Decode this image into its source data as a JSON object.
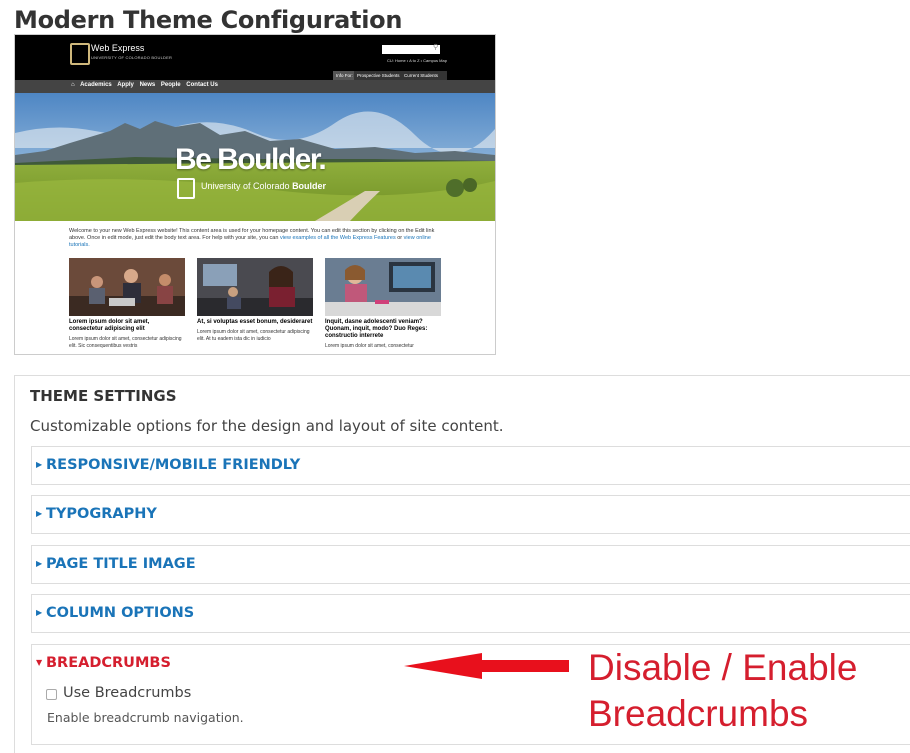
{
  "page": {
    "title": "Modern Theme Configuration"
  },
  "preview": {
    "site_name": "Web Express",
    "site_sub": "UNIVERSITY OF COLORADO BOULDER",
    "top_links": "CU: Home • A to Z • Campus Map",
    "info_for_label": "Info For:",
    "info_for_items": [
      "Prospective Students",
      "Current Students"
    ],
    "nav_items": [
      "Academics",
      "Apply",
      "News",
      "People",
      "Contact Us"
    ],
    "hero_title": "Be Boulder.",
    "hero_sub_regular": "University of Colorado",
    "hero_sub_bold": "Boulder",
    "intro_text": "Welcome to your new Web Express website! This content area is used for your homepage content. You can edit this section by clicking on the Edit link above. Once in edit mode, just edit the body text area. For help with your site, you can",
    "intro_link1": "view examples of all the Web Express Features",
    "intro_or": "or",
    "intro_link2": "view online tutorials.",
    "cards": [
      {
        "title": "Lorem ipsum dolor sit amet, consectetur adipiscing elit",
        "body": "Lorem ipsum dolor sit amet, consectetur adipiscing elit. Sic consequentibus vestris"
      },
      {
        "title": "At, si voluptas esset bonum, desideraret",
        "body": "Lorem ipsum dolor sit amet, consectetur adipiscing elit. At tu eadem ista dic in iudicio"
      },
      {
        "title": "Inquit, dasne adolescenti veniam? Quonam, inquit, modo? Duo Reges: constructio interrete",
        "body": "Lorem ipsum dolor sit amet, consectetur"
      }
    ]
  },
  "settings": {
    "title": "THEME SETTINGS",
    "description": "Customizable options for the design and layout of site content.",
    "sections": [
      {
        "label": "RESPONSIVE/MOBILE FRIENDLY",
        "expanded": false
      },
      {
        "label": "TYPOGRAPHY",
        "expanded": false
      },
      {
        "label": "PAGE TITLE IMAGE",
        "expanded": false
      },
      {
        "label": "COLUMN OPTIONS",
        "expanded": false
      },
      {
        "label": "BREADCRUMBS",
        "expanded": true
      }
    ],
    "breadcrumbs": {
      "checkbox_label": "Use Breadcrumbs",
      "checked": false,
      "help": "Enable breadcrumb navigation."
    }
  },
  "annotation": {
    "line1": "Disable / Enable",
    "line2": "Breadcrumbs"
  },
  "colors": {
    "link": "#1a74b8",
    "active": "#d51e2e",
    "annotation": "#d51e2e",
    "cu_gold": "#cfb87c"
  },
  "icons": [
    "search-icon",
    "home-icon",
    "caret-right-icon",
    "caret-down-icon",
    "arrow-left-icon"
  ]
}
